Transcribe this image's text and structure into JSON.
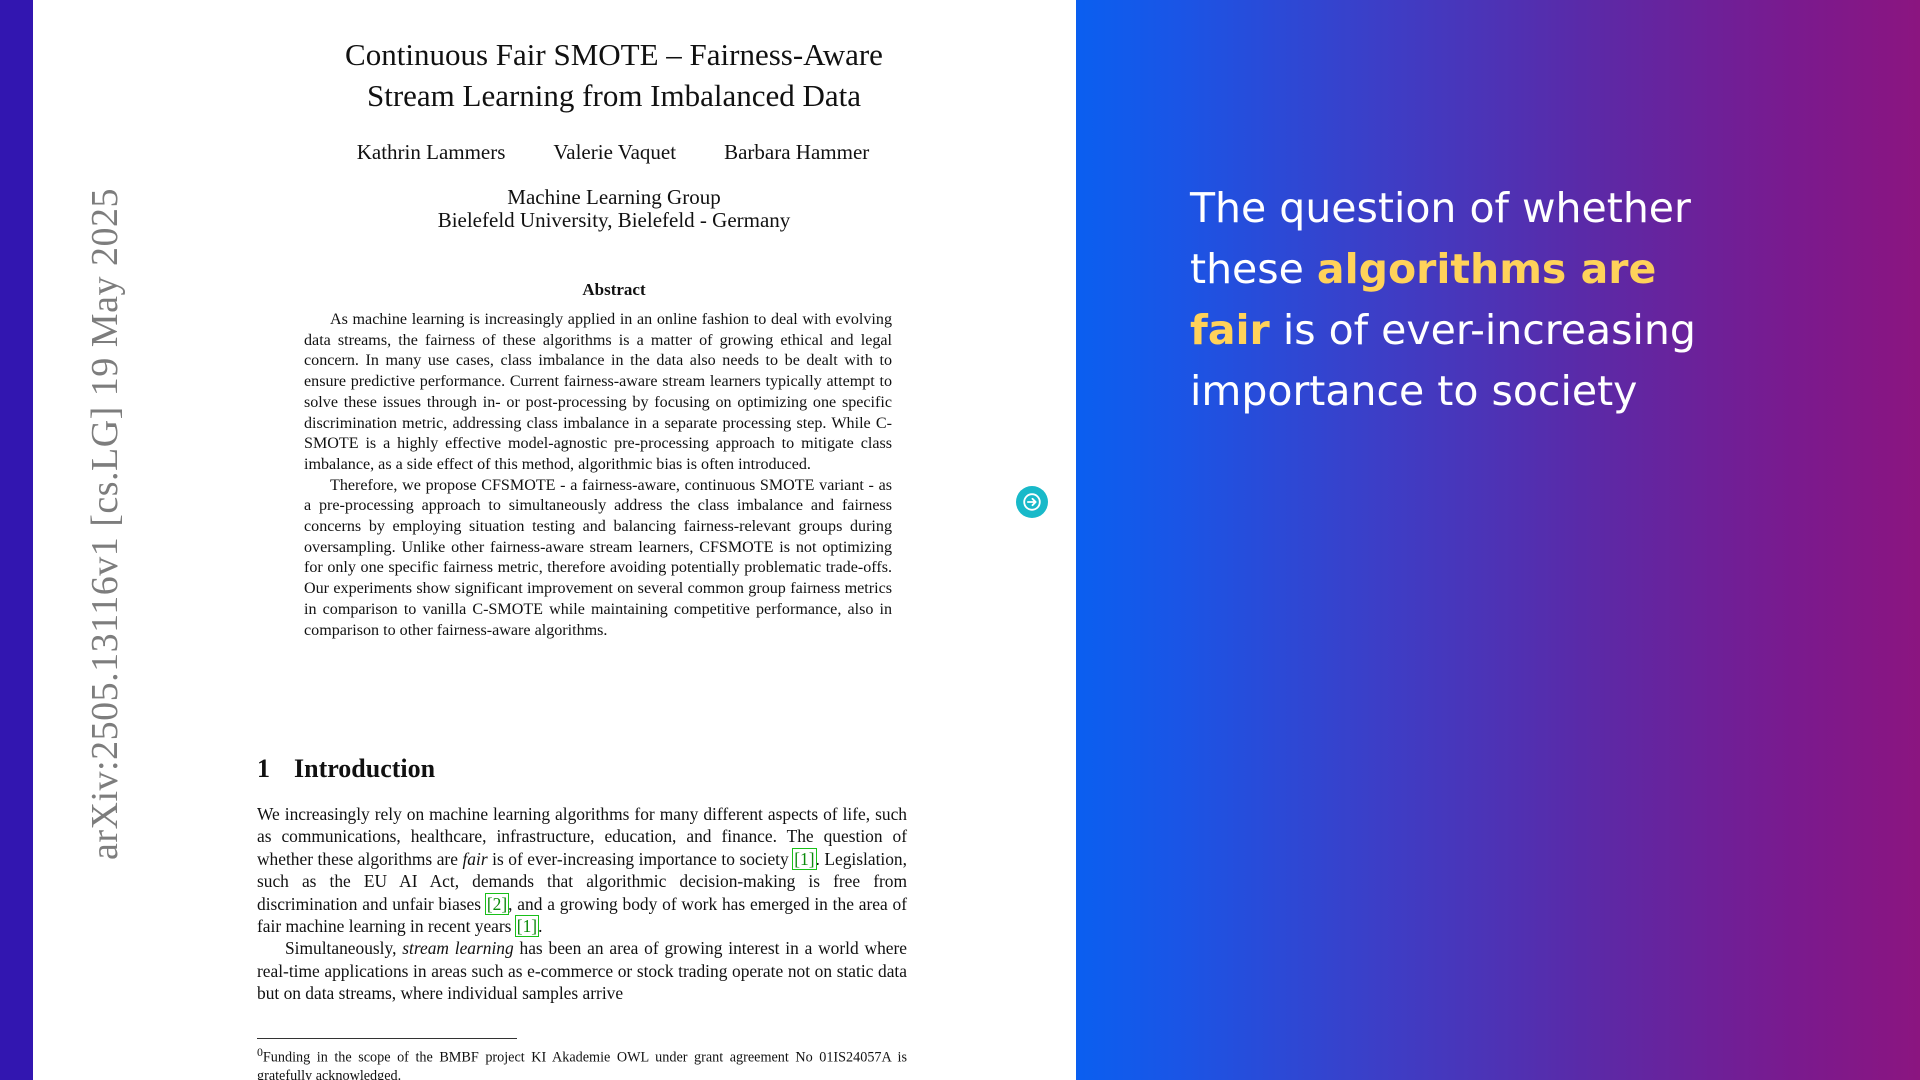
{
  "sidebar": {
    "arxiv_id": "arXiv:2505.13116v1  [cs.LG]  19 May 2025"
  },
  "paper": {
    "title_line1": "Continuous Fair SMOTE – Fairness-Aware",
    "title_line2": "Stream Learning from Imbalanced Data",
    "authors": [
      "Kathrin Lammers",
      "Valerie Vaquet",
      "Barbara Hammer"
    ],
    "affiliation_line1": "Machine Learning Group",
    "affiliation_line2": "Bielefeld University, Bielefeld - Germany",
    "abstract_heading": "Abstract",
    "abstract_p1": "As machine learning is increasingly applied in an online fashion to deal with evolving data streams, the fairness of these algorithms is a matter of growing ethical and legal concern. In many use cases, class imbalance in the data also needs to be dealt with to ensure predictive performance. Current fairness-aware stream learners typically attempt to solve these issues through in- or post-processing by focusing on optimizing one specific discrimination metric, addressing class imbalance in a separate processing step. While C-SMOTE is a highly effective model-agnostic pre-processing approach to mitigate class imbalance, as a side effect of this method, algorithmic bias is often introduced.",
    "abstract_p2": "Therefore, we propose CFSMOTE - a fairness-aware, continuous SMOTE variant - as a pre-processing approach to simultaneously address the class imbalance and fairness concerns by employing situation testing and balancing fairness-relevant groups during oversampling. Unlike other fairness-aware stream learners, CFSMOTE is not optimizing for only one specific fairness metric, therefore avoiding potentially problematic trade-offs. Our experiments show significant improvement on several common group fairness metrics in comparison to vanilla C-SMOTE while maintaining competitive performance, also in comparison to other fairness-aware algorithms.",
    "section_number": "1",
    "section_title": "Introduction",
    "intro_p1": {
      "a": "We increasingly rely on machine learning algorithms for many different aspects of life, such as communications, healthcare, infrastructure, education, and finance. The question of whether these algorithms are ",
      "em": "fair",
      "b": " is of ever-increasing importance to society ",
      "cite1": "[1]",
      "c": ". Legislation, such as the EU AI Act, demands that algorithmic decision-making is free from discrimination and unfair biases ",
      "cite2": "[2]",
      "d": ", and a growing body of work has emerged in the area of fair machine learning in recent years ",
      "cite3": "[1]",
      "e": "."
    },
    "intro_p2": {
      "a": "Simultaneously, ",
      "em": "stream learning",
      "b": " has been an area of growing interest in a world where real-time applications in areas such as e-commerce or stock trading operate not on static data but on data streams, where individual samples arrive"
    },
    "footnote": {
      "mark": "0",
      "text": "Funding in the scope of the BMBF project KI Akademie OWL under grant agreement No 01IS24057A is gratefully acknowledged."
    }
  },
  "nav": {
    "icon": "arrow-right-icon"
  },
  "quote": {
    "part1": "The question of whether these ",
    "highlight": "algorithms are fair",
    "part2": " is of ever-increasing importance to society"
  },
  "colors": {
    "highlight": "#ffd25a",
    "citation": "#0a8a0a",
    "nav_button": "#18b9c9"
  }
}
